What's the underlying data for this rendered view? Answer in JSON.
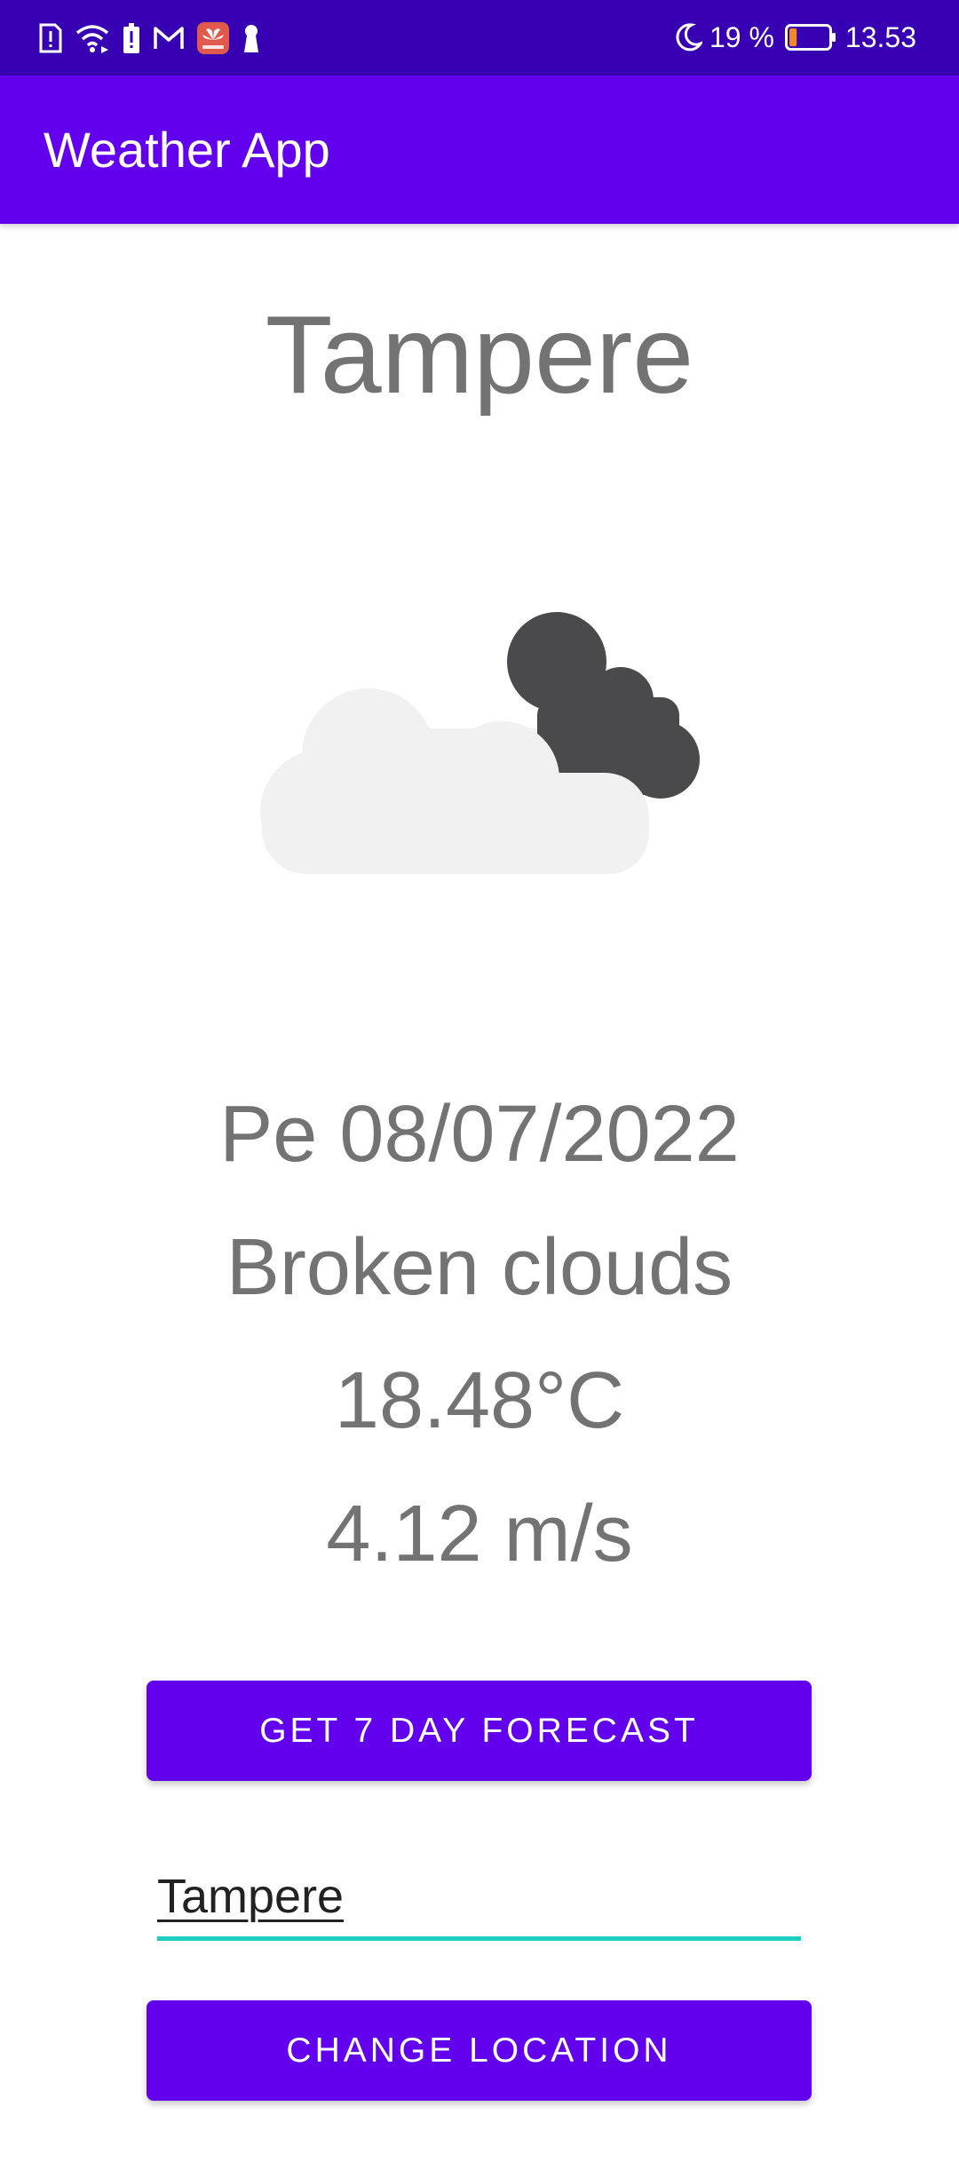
{
  "status_bar": {
    "icons": [
      "sim-alert-icon",
      "wifi-icon",
      "battery-alert-icon",
      "gmail-icon",
      "huawei-app-icon",
      "keyhole-icon",
      "moon-icon"
    ],
    "battery_percent": "19 %",
    "battery_level": 0.19,
    "time": "13.53",
    "colors": {
      "background": "#3700b3",
      "battery_fill": "#f08a24"
    }
  },
  "app_bar": {
    "title": "Weather App",
    "background": "#6200ee"
  },
  "weather": {
    "city": "Tampere",
    "icon": "broken-clouds-icon",
    "date": "Pe 08/07/2022",
    "description": "Broken clouds",
    "temperature": "18.48°C",
    "wind_speed": "4.12 m/s"
  },
  "actions": {
    "forecast_label": "GET 7 DAY FORECAST",
    "location_value": "Tampere",
    "change_location_label": "CHANGE LOCATION"
  },
  "colors": {
    "primary": "#6200ee",
    "primary_dark": "#3700b3",
    "accent": "#1ccfc0",
    "text_secondary": "#737373"
  }
}
